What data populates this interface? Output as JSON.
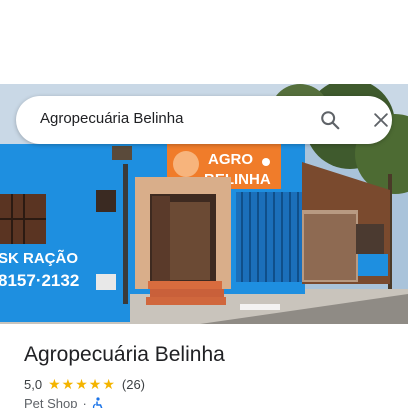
{
  "search": {
    "query": "Agropecuária Belinha",
    "search_icon": "search-icon",
    "close_icon": "close-icon"
  },
  "photo": {
    "sign_line1": "AGRO",
    "sign_line2": "BELINHA",
    "wall_text1": "SK RAÇÃO",
    "wall_text2": "8157·2132"
  },
  "place": {
    "title": "Agropecuária Belinha",
    "rating": "5,0",
    "stars": [
      "★",
      "★",
      "★",
      "★",
      "★"
    ],
    "review_count": "(26)",
    "category": "Pet Shop",
    "separator": "·",
    "accessibility_icon": "wheelchair-accessible-icon"
  },
  "colors": {
    "star": "#f4b400",
    "wall_blue": "#1e8fe0",
    "sign_orange": "#f07c2a",
    "accent_blue": "#1a73e8"
  }
}
